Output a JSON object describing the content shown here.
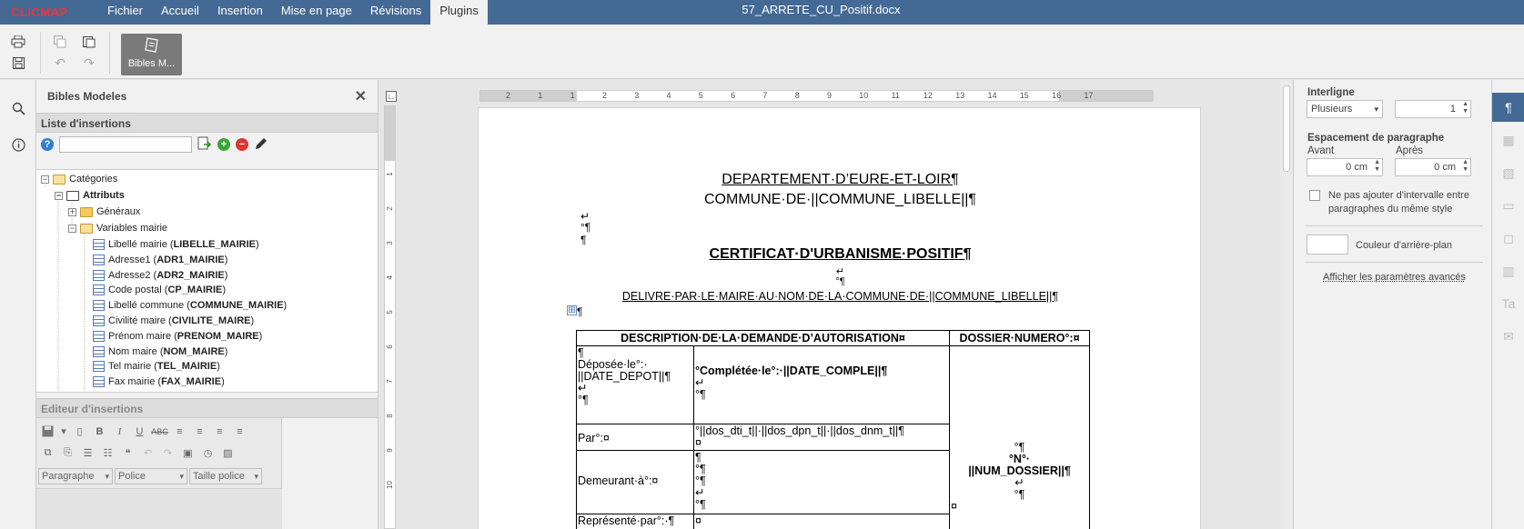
{
  "app": {
    "logo": "CLICMAP",
    "document_title": "57_ARRETE_CU_Positif.docx",
    "menu_tabs": [
      "Fichier",
      "Accueil",
      "Insertion",
      "Mise en page",
      "Révisions",
      "Plugins"
    ],
    "active_tab": "Plugins",
    "colors": {
      "header": "#446995",
      "logo": "#e8363d"
    }
  },
  "toolbar": {
    "bibles_button_label": "Bibles M...",
    "icons": [
      "print-icon",
      "save-icon",
      "copy-icon",
      "paste-icon",
      "undo-icon",
      "redo-icon",
      "bibles-icon"
    ]
  },
  "left_bar": {
    "icons": [
      "search-icon",
      "info-icon"
    ]
  },
  "bibles_panel": {
    "title": "Bibles Modeles",
    "list_title": "Liste d'insertions",
    "search_value": "",
    "tree": {
      "root": "Catégories",
      "attributs": "Attributs",
      "generaux": "Généraux",
      "variables_mairie": "Variables mairie",
      "items": [
        {
          "label": "Libellé mairie (",
          "code": "LIBELLE_MAIRIE",
          "end": ")"
        },
        {
          "label": "Adresse1 (",
          "code": "ADR1_MAIRIE",
          "end": ")"
        },
        {
          "label": "Adresse2 (",
          "code": "ADR2_MAIRIE",
          "end": ")"
        },
        {
          "label": "Code postal (",
          "code": "CP_MAIRIE",
          "end": ")"
        },
        {
          "label": "Libellé commune (",
          "code": "COMMUNE_MAIRIE",
          "end": ")"
        },
        {
          "label": "Civilité maire (",
          "code": "CIVILITE_MAIRE",
          "end": ")"
        },
        {
          "label": "Prénom maire (",
          "code": "PRENOM_MAIRE",
          "end": ")"
        },
        {
          "label": "Nom maire (",
          "code": "NOM_MAIRE",
          "end": ")"
        },
        {
          "label": "Tel mairie (",
          "code": "TEL_MAIRIE",
          "end": ")"
        },
        {
          "label": "Fax mairie (",
          "code": "FAX_MAIRIE",
          "end": ")"
        }
      ]
    },
    "editor_title": "Editeur d'insertions",
    "editor_selects": {
      "paragraph": "Paragraphe",
      "font": "Police",
      "size": "Taille police"
    }
  },
  "ruler": {
    "h_ticks": [
      "2",
      "1",
      "1",
      "2",
      "3",
      "4",
      "5",
      "6",
      "7",
      "8",
      "9",
      "10",
      "11",
      "12",
      "13",
      "14",
      "15",
      "16",
      "17"
    ],
    "v_ticks": [
      "1",
      "2",
      "3",
      "4",
      "5",
      "6",
      "7",
      "8",
      "9",
      "10"
    ]
  },
  "document": {
    "line1": "DEPARTEMENT·D’EURE-ET-LOIR¶",
    "line2": "COMMUNE·DE·||COMMUNE_LIBELLE||¶",
    "title": "CERTIFICAT·D'URBANISME·POSITIF¶",
    "delivre": "DELIVRE·PAR·LE·MAIRE·AU·NOM·DE·LA·COMMUNE·DE·||COMMUNE_LIBELLE||¶",
    "marks": {
      "br": "↵",
      "para": "¶",
      "degpara": "°¶",
      "cell": "¤",
      "table_handle": "⊞"
    },
    "table": {
      "header_left": "DESCRIPTION·DE·LA·DEMANDE·D’AUTORISATION¤",
      "header_right": "DOSSIER·NUMERO°:¤",
      "deposee_1": "Déposée·le°:·",
      "deposee_2": "||DATE_DEPOT||¶",
      "completee": "°Complétée·le°:·||DATE_COMPLE||¶",
      "par": "Par°:¤",
      "par_value": "°||dos_dti_t||·||dos_dpn_t||·||dos_dnm_t||¶",
      "demeurant": "Demeurant·à°:¤",
      "represente": "Représenté·par°:·¶",
      "num_label": "°N°·",
      "num_value": "||NUM_DOSSIER||¶"
    }
  },
  "right_panel": {
    "interligne_label": "Interligne",
    "interligne_mode": "Plusieurs",
    "interligne_value": "1",
    "espacement_label": "Espacement de paragraphe",
    "avant_label": "Avant",
    "apres_label": "Après",
    "avant_value": "0 cm",
    "apres_value": "0 cm",
    "no_interval_label": "Ne pas ajouter d'intervalle entre paragraphes du même style",
    "bg_color_label": "Couleur d'arrière-plan",
    "advanced_link": "Afficher les paramètres avancés"
  },
  "right_icon_bar": {
    "icons": [
      "paragraph-icon",
      "table-icon",
      "image-icon",
      "header-footer-icon",
      "shape-icon",
      "chart-icon",
      "text-art-icon",
      "mail-merge-icon"
    ]
  }
}
